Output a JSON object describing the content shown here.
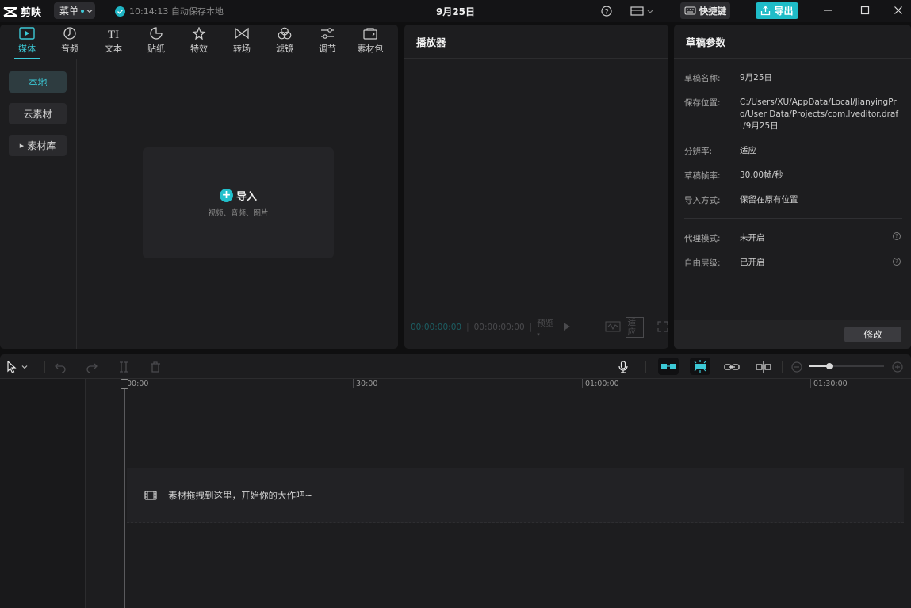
{
  "titlebar": {
    "app_name": "剪映",
    "menu_label": "菜单",
    "save_status": "10:14:13 自动保存本地",
    "project_title": "9月25日",
    "shortcut_label": "快捷键",
    "export_label": "导出"
  },
  "media_panel": {
    "tabs": [
      {
        "label": "媒体",
        "icon": "media-icon",
        "active": true
      },
      {
        "label": "音频",
        "icon": "audio-icon"
      },
      {
        "label": "文本",
        "icon": "text-icon"
      },
      {
        "label": "贴纸",
        "icon": "sticker-icon"
      },
      {
        "label": "特效",
        "icon": "effects-icon"
      },
      {
        "label": "转场",
        "icon": "transition-icon"
      },
      {
        "label": "滤镜",
        "icon": "filter-icon"
      },
      {
        "label": "调节",
        "icon": "adjust-icon"
      },
      {
        "label": "素材包",
        "icon": "package-icon"
      }
    ],
    "sidebar": [
      {
        "label": "本地",
        "active": true
      },
      {
        "label": "云素材"
      },
      {
        "label": "素材库"
      }
    ],
    "import_label": "导入",
    "import_hint": "视频、音频、图片"
  },
  "player": {
    "title": "播放器",
    "current_time": "00:00:00:00",
    "total_time": "00:00:00:00",
    "quality": "预览",
    "ratio": "适应"
  },
  "draft": {
    "title": "草稿参数",
    "fields": [
      {
        "label": "草稿名称:",
        "value": "9月25日"
      },
      {
        "label": "保存位置:",
        "value": "C:/Users/XU/AppData/Local/JianyingPro/User Data/Projects/com.lveditor.draft/9月25日"
      },
      {
        "label": "分辨率:",
        "value": "适应"
      },
      {
        "label": "草稿帧率:",
        "value": "30.00帧/秒"
      },
      {
        "label": "导入方式:",
        "value": "保留在原有位置"
      },
      {
        "label": "代理模式:",
        "value": "未开启"
      },
      {
        "label": "自由层级:",
        "value": "已开启"
      }
    ],
    "edit_label": "修改"
  },
  "timeline": {
    "ruler": [
      "00:00",
      "30:00",
      "01:00:00",
      "01:30:00"
    ],
    "drop_hint": "素材拖拽到这里，开始你的大作吧~"
  },
  "colors": {
    "accent": "#1fbcc8",
    "panel": "#1d1d1f",
    "background": "#0f0f10"
  }
}
